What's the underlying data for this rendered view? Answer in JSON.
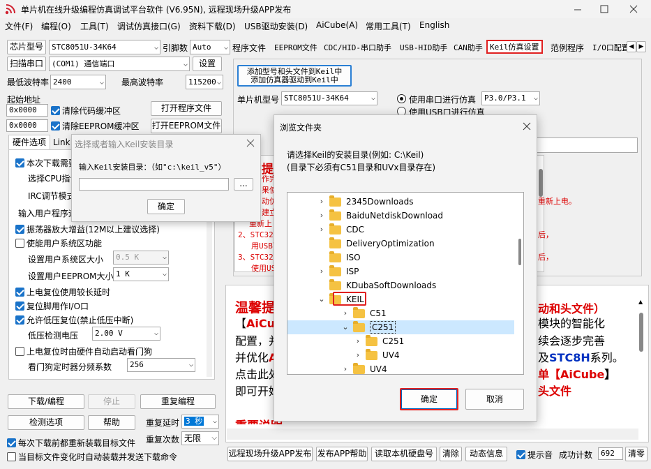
{
  "window": {
    "title": "单片机在线升级编程仿真调试平台软件 (V6.95N), 远程现场升级APP发布"
  },
  "menu": [
    "文件(F)",
    "编程(O)",
    "工具(T)",
    "调试仿真接口(G)",
    "资料下载(D)",
    "USB驱动安装(D)",
    "AiCube(A)",
    "常用工具(T)",
    "English"
  ],
  "left": {
    "chip_label": "芯片型号",
    "chip_value": "STC8051U-34K64",
    "pin_label": "引脚数",
    "pin_value": "Auto",
    "scan_button": "扫描串口",
    "port_value": "(COM1) 通信端口",
    "settings_button": "设置",
    "min_baud_label": "最低波特率",
    "min_baud_value": "2400",
    "max_baud_label": "最高波特率",
    "max_baud_value": "115200",
    "start_addr_label": "起始地址",
    "addr1": "0x0000",
    "clear_code": "清除代码缓冲区",
    "open_prog": "打开程序文件",
    "addr2": "0x0000",
    "clear_eeprom": "清除EEPROM缓冲区",
    "open_eeprom": "打开EEPROM文件",
    "hw_tab": "硬件选项",
    "link_tab": "Link",
    "opt_items": [
      "本次下载需要",
      "选择CPU指令",
      "IRC调节模式",
      "输入用户程序运"
    ],
    "osc_gain": "振荡器放大增益(12M以上建议选择)",
    "enable_sys": "使能用户系统区功能",
    "sys_size_label": "设置用户系统区大小",
    "sys_size_value": "0.5 K",
    "eeprom_size_label": "设置用户EEPROM大小",
    "eeprom_size_value": "1    K",
    "long_delay": "上电复位使用较长延时",
    "reset_io": "复位脚用作I/O口",
    "lvd_reset": "允许低压复位(禁止低压中断)",
    "lvd_label": "低压检测电压",
    "lvd_value": "2.00 V",
    "wdt_auto": "上电复位时由硬件自动启动看门狗",
    "wdt_label": "看门狗定时器分频系数",
    "wdt_value": "256",
    "download_btn": "下载/编程",
    "stop_btn": "停止",
    "reprog_btn": "重复编程",
    "check_btn": "检测选项",
    "help_btn": "帮助",
    "repeat_delay_label": "重复延时",
    "repeat_delay_value": "3 秒",
    "repeat_count_label": "重复次数",
    "repeat_count_value": "无限",
    "reload_each": "每次下载前都重新装载目标文件",
    "auto_send": "当目标文件变化时自动装载并发送下载命令"
  },
  "tabs": [
    "程序文件",
    "EEPROM文件",
    "CDC/HID-串口助手",
    "USB-HID助手",
    "CAN助手",
    "Keil仿真设置",
    "范例程序",
    "I/O口配置"
  ],
  "keil": {
    "add_btn_line1": "添加型号和头文件到Keil中",
    "add_btn_line2": "添加仿真器驱动到Keil中",
    "mcu_label": "单片机型号",
    "mcu_value": "STC8051U-34K64",
    "radio_serial": "使用串口进行仿真",
    "serial_port_value": "P3.0/P3.1",
    "radio_usb": "使用USB口进行仿真",
    "tip_char": "提",
    "tip_lines": [
      "作完",
      "果使",
      "动仿",
      "建立",
      "重新上",
      "2、STC32",
      "用USB下",
      "3、STC32",
      "使用US"
    ],
    "tip_right1": "重新上电。",
    "tip_right2": "后，",
    "tip_right3": "后，"
  },
  "bottom_info": {
    "heading": "温馨提",
    "heading_right": "动和头文件）",
    "line1_a": "【",
    "line1_b": "AiCub",
    "line1_right": "模块的智能化",
    "line2": "配置，并",
    "line2_right": "续会逐步完善",
    "line3_a": "并优化",
    "line3_b": "A",
    "line3_right_a": "及",
    "line3_right_b": "STC8H",
    "line3_right_c": "系列。",
    "line4": "点击此处",
    "line4_right_a": "单【",
    "line4_right_b": "AiCube",
    "line4_right_c": "】",
    "line5": "即可开始",
    "line5_right": "头文件",
    "line6": "重要说明"
  },
  "statusbar": {
    "remote_btn": "远程现场升级APP发布",
    "publish_help": "发布APP帮助",
    "read_disk": "读取本机硬盘号",
    "clear_btn": "清除",
    "dynamic_btn": "动态信息",
    "sound_label": "提示音",
    "success_label": "成功计数",
    "success_value": "692",
    "reset_btn": "清零"
  },
  "dialog_small": {
    "title": "选择或者输入Keil安装目录",
    "label": "输入Keil安装目录：（如\"c:\\keil_v5\"）",
    "input_value": "",
    "browse_btn": "...",
    "ok_btn": "确定"
  },
  "dialog_browse": {
    "title": "浏览文件夹",
    "desc1": "请选择Keil的安装目录(例如: C:\\Keil)",
    "desc2": "(目录下必须有C51目录和UVx目录存在)",
    "tree": [
      {
        "label": "2345Downloads",
        "level": 1,
        "exp": ">"
      },
      {
        "label": "BaiduNetdiskDownload",
        "level": 1,
        "exp": ">"
      },
      {
        "label": "CDC",
        "level": 1,
        "exp": ">"
      },
      {
        "label": "DeliveryOptimization",
        "level": 1,
        "exp": ""
      },
      {
        "label": "ISO",
        "level": 1,
        "exp": ""
      },
      {
        "label": "ISP",
        "level": 1,
        "exp": ">"
      },
      {
        "label": "KDubaSoftDownloads",
        "level": 1,
        "exp": ""
      },
      {
        "label": "KEIL",
        "level": 1,
        "exp": "v"
      },
      {
        "label": "C51",
        "level": 2,
        "exp": ">"
      },
      {
        "label": "C251",
        "level": 2,
        "exp": "v"
      },
      {
        "label": "C251",
        "level": 3,
        "exp": ">"
      },
      {
        "label": "UV4",
        "level": 3,
        "exp": ">"
      },
      {
        "label": "UV4",
        "level": 2,
        "exp": ">"
      }
    ],
    "ok_btn": "确定",
    "cancel_btn": "取消"
  },
  "colors": {
    "highlight": "#e02020",
    "selection": "#cce8ff",
    "checkbox": "#1a73c9",
    "red_text": "#d00000",
    "blue_text": "#0030c0"
  }
}
